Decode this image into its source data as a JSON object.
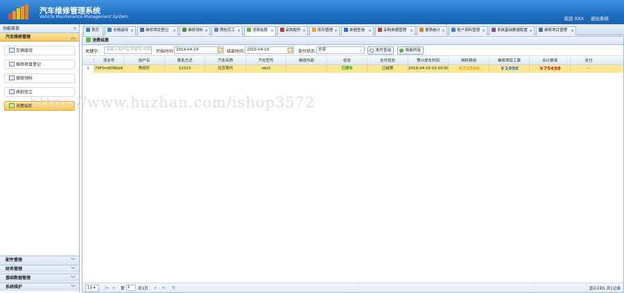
{
  "header": {
    "title": "汽车维修管理系统",
    "subtitle": "Vehicle Maintenance Management System",
    "welcome": "欢迎 XXX",
    "logout": "退出系统"
  },
  "sidebar": {
    "heading": "功能菜单",
    "active_group": "汽车维修管理",
    "items": [
      {
        "label": "车辆接待"
      },
      {
        "label": "维修项目登记"
      },
      {
        "label": "维修领料"
      },
      {
        "label": "质检完工"
      },
      {
        "label": "消费结算"
      }
    ],
    "bottom_groups": [
      {
        "label": "配件管理"
      },
      {
        "label": "财务管理"
      },
      {
        "label": "基础数据管理"
      },
      {
        "label": "系统维护"
      }
    ]
  },
  "tabs": [
    {
      "label": "首页",
      "color": "#3b7dd8"
    },
    {
      "label": "车辆接待",
      "color": "#3b7dd8"
    },
    {
      "label": "维修项目登记",
      "color": "#4a6fa5"
    },
    {
      "label": "维修领料",
      "color": "#5a8a3a"
    },
    {
      "label": "质检完工",
      "color": "#6b8bb5"
    },
    {
      "label": "消费结算",
      "color": "#6ab04c"
    },
    {
      "label": "采购配件",
      "color": "#c0392b"
    },
    {
      "label": "库存管理",
      "color": "#e6a23c"
    },
    {
      "label": "单据查询",
      "color": "#2f6fcc"
    },
    {
      "label": "采购单据管理",
      "color": "#c0392b"
    },
    {
      "label": "报表统计",
      "color": "#e67e22"
    },
    {
      "label": "客户资料管理",
      "color": "#3b7dd8"
    },
    {
      "label": "系统基础数据配置",
      "color": "#8e44ad"
    },
    {
      "label": "维修项目管理",
      "color": "#4a6fa5"
    }
  ],
  "panel": {
    "title": "消费结算"
  },
  "filters": {
    "keyword_label": "关键字:",
    "keyword_placeholder": "请输入用户名/手机号/车牌",
    "start_label": "开始时间:",
    "start_value": "2019-04-19",
    "end_label": "结束时间:",
    "end_value": "2019-04-19",
    "pay_label": "支付状态:",
    "pay_value": "全部",
    "search_button": "条件查询",
    "refresh_button": "刷新所有"
  },
  "table": {
    "columns": [
      "流水号",
      "用户名",
      "联系方式",
      "汽车名称",
      "汽车型号",
      "维修内容",
      "状态",
      "支付状态",
      "预计提车时间",
      "用料费用",
      "维修项目工费",
      "合计费用",
      "支付"
    ],
    "rows": [
      {
        "num": "1",
        "serial": "79F0m8O8jib6",
        "user": "陈田乐",
        "contact": "12323",
        "car_name": "北京现代",
        "car_model": "sds3",
        "content": "",
        "status": "已提车",
        "pay_status": "已结算",
        "pickup_time": "2019-04-19 02:03:00",
        "material_fee": "￥73500",
        "labor_fee": "￥1998",
        "total_fee": "￥75498",
        "pay": "--"
      }
    ]
  },
  "pager": {
    "page_size": "10",
    "page_prefix": "第",
    "page_value": "1",
    "page_suffix": "共1页",
    "info": "显示1到1,共1记录"
  },
  "watermark": "https://www.huzhan.com/ishop3572"
}
